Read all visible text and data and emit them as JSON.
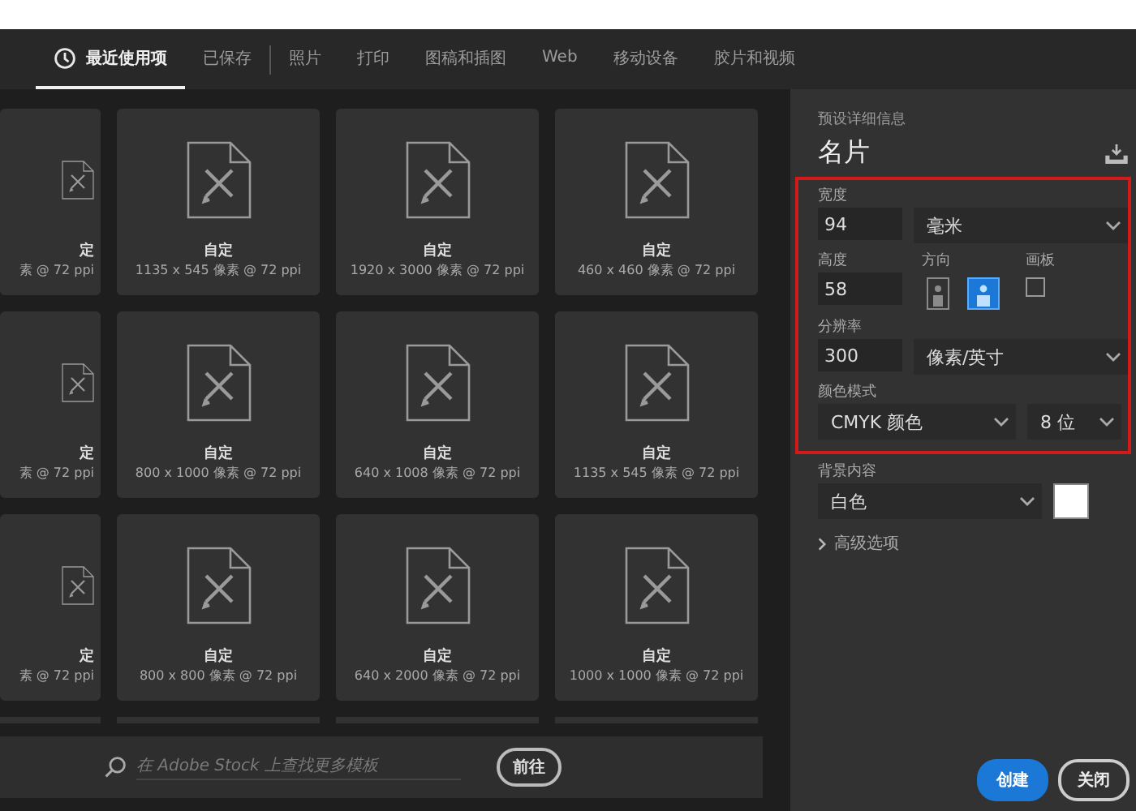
{
  "tabs": [
    {
      "label": "最近使用项",
      "selected": true,
      "kind": "recent"
    },
    {
      "label": "已保存",
      "selected": false,
      "kind": "saved"
    },
    {
      "label": "照片",
      "selected": false,
      "kind": "category"
    },
    {
      "label": "打印",
      "selected": false,
      "kind": "category"
    },
    {
      "label": "图稿和插图",
      "selected": false,
      "kind": "category"
    },
    {
      "label": "Web",
      "selected": false,
      "kind": "category"
    },
    {
      "label": "移动设备",
      "selected": false,
      "kind": "category"
    },
    {
      "label": "胶片和视频",
      "selected": false,
      "kind": "category"
    }
  ],
  "preset_rows": [
    [
      {
        "kind": "cut",
        "name": "定",
        "size": "素 @ 72 ppi"
      },
      {
        "kind": "full",
        "name": "自定",
        "size": "1135 x 545 像素 @ 72 ppi"
      },
      {
        "kind": "full",
        "name": "自定",
        "size": "1920 x 3000 像素 @ 72 ppi"
      },
      {
        "kind": "full",
        "name": "自定",
        "size": "460 x 460 像素 @ 72 ppi"
      }
    ],
    [
      {
        "kind": "cut",
        "name": "定",
        "size": "素 @ 72 ppi"
      },
      {
        "kind": "full",
        "name": "自定",
        "size": "800 x 1000 像素 @ 72 ppi"
      },
      {
        "kind": "full",
        "name": "自定",
        "size": "640 x 1008 像素 @ 72 ppi"
      },
      {
        "kind": "full",
        "name": "自定",
        "size": "1135 x 545 像素 @ 72 ppi"
      }
    ],
    [
      {
        "kind": "cut",
        "name": "定",
        "size": "素 @ 72 ppi"
      },
      {
        "kind": "full",
        "name": "自定",
        "size": "800 x 800 像素 @ 72 ppi"
      },
      {
        "kind": "full",
        "name": "自定",
        "size": "640 x 2000 像素 @ 72 ppi"
      },
      {
        "kind": "full",
        "name": "自定",
        "size": "1000 x 1000 像素 @ 72 ppi"
      }
    ]
  ],
  "stock_search": {
    "placeholder": "在 Adobe Stock 上查找更多模板",
    "button": "前往"
  },
  "details": {
    "heading": "预设详细信息",
    "name": "名片",
    "width": {
      "label": "宽度",
      "value": "94",
      "unit": "毫米"
    },
    "height": {
      "label": "高度",
      "value": "58"
    },
    "orientation": {
      "label": "方向",
      "options": [
        {
          "selected": false
        },
        {
          "selected": true
        }
      ]
    },
    "artboard": {
      "label": "画板",
      "checked": false
    },
    "resolution": {
      "label": "分辨率",
      "value": "300",
      "unit": "像素/英寸"
    },
    "color_mode": {
      "label": "颜色模式",
      "value": "CMYK 颜色",
      "depth": "8 位"
    },
    "background": {
      "label": "背景内容",
      "value": "白色",
      "color": "#ffffff"
    },
    "advanced": {
      "label": "高级选项",
      "expanded": false
    }
  },
  "buttons": [
    {
      "label": "创建",
      "kind": "primary"
    },
    {
      "label": "关闭",
      "kind": "secondary"
    }
  ]
}
